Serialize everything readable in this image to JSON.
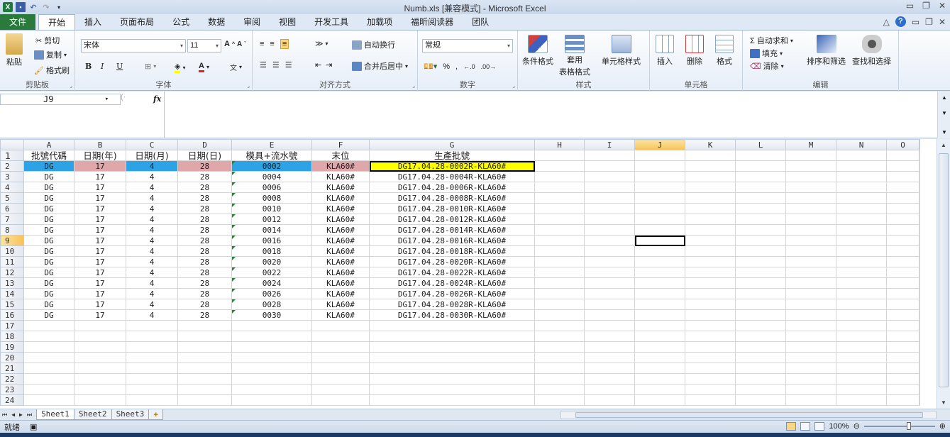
{
  "window": {
    "title": "Numb.xls  [兼容模式] - Microsoft Excel"
  },
  "ribbon_tabs": [
    "文件",
    "开始",
    "插入",
    "页面布局",
    "公式",
    "数据",
    "审阅",
    "视图",
    "开发工具",
    "加载项",
    "福昕阅读器",
    "团队"
  ],
  "active_tab": "开始",
  "clipboard": {
    "paste": "粘贴",
    "cut": "剪切",
    "copy": "复制",
    "format_painter": "格式刷",
    "label": "剪贴板"
  },
  "font": {
    "name": "宋体",
    "size": "11",
    "label": "字体",
    "bold": "B",
    "italic": "I",
    "underline": "U"
  },
  "alignment": {
    "wrap": "自动换行",
    "merge": "合并后居中",
    "label": "对齐方式"
  },
  "number": {
    "format": "常规",
    "label": "数字",
    "percent": "%",
    "comma": ","
  },
  "styles": {
    "conditional": "条件格式",
    "table_format": "套用\n表格格式",
    "table_format_a": "套用",
    "table_format_b": "表格格式",
    "cell_styles": "单元格样式",
    "label": "样式"
  },
  "cells": {
    "insert": "插入",
    "delete": "删除",
    "format": "格式",
    "label": "单元格"
  },
  "editing": {
    "autosum": "Σ 自动求和",
    "fill": "填充",
    "clear": "清除",
    "sort": "排序和筛选",
    "find": "查找和选择",
    "label": "编辑"
  },
  "formula_bar": {
    "name_box": "J9",
    "fx": "fx",
    "content": ""
  },
  "columns": [
    "A",
    "B",
    "C",
    "D",
    "E",
    "F",
    "G",
    "H",
    "I",
    "J",
    "K",
    "L",
    "M",
    "N",
    "O"
  ],
  "header_row": [
    "批號代碼",
    "日期(年)",
    "日期(月)",
    "日期(日)",
    "模具+流水號",
    "末位",
    "生產批號"
  ],
  "rows": [
    [
      "DG",
      "17",
      "4",
      "28",
      "0002",
      "KLA60#",
      "DG17.04.28-0002R-KLA60#"
    ],
    [
      "DG",
      "17",
      "4",
      "28",
      "0004",
      "KLA60#",
      "DG17.04.28-0004R-KLA60#"
    ],
    [
      "DG",
      "17",
      "4",
      "28",
      "0006",
      "KLA60#",
      "DG17.04.28-0006R-KLA60#"
    ],
    [
      "DG",
      "17",
      "4",
      "28",
      "0008",
      "KLA60#",
      "DG17.04.28-0008R-KLA60#"
    ],
    [
      "DG",
      "17",
      "4",
      "28",
      "0010",
      "KLA60#",
      "DG17.04.28-0010R-KLA60#"
    ],
    [
      "DG",
      "17",
      "4",
      "28",
      "0012",
      "KLA60#",
      "DG17.04.28-0012R-KLA60#"
    ],
    [
      "DG",
      "17",
      "4",
      "28",
      "0014",
      "KLA60#",
      "DG17.04.28-0014R-KLA60#"
    ],
    [
      "DG",
      "17",
      "4",
      "28",
      "0016",
      "KLA60#",
      "DG17.04.28-0016R-KLA60#"
    ],
    [
      "DG",
      "17",
      "4",
      "28",
      "0018",
      "KLA60#",
      "DG17.04.28-0018R-KLA60#"
    ],
    [
      "DG",
      "17",
      "4",
      "28",
      "0020",
      "KLA60#",
      "DG17.04.28-0020R-KLA60#"
    ],
    [
      "DG",
      "17",
      "4",
      "28",
      "0022",
      "KLA60#",
      "DG17.04.28-0022R-KLA60#"
    ],
    [
      "DG",
      "17",
      "4",
      "28",
      "0024",
      "KLA60#",
      "DG17.04.28-0024R-KLA60#"
    ],
    [
      "DG",
      "17",
      "4",
      "28",
      "0026",
      "KLA60#",
      "DG17.04.28-0026R-KLA60#"
    ],
    [
      "DG",
      "17",
      "4",
      "28",
      "0028",
      "KLA60#",
      "DG17.04.28-0028R-KLA60#"
    ],
    [
      "DG",
      "17",
      "4",
      "28",
      "0030",
      "KLA60#",
      "DG17.04.28-0030R-KLA60#"
    ]
  ],
  "row_numbers": [
    "1",
    "2",
    "3",
    "4",
    "5",
    "6",
    "7",
    "8",
    "9",
    "10",
    "11",
    "12",
    "13",
    "14",
    "15",
    "16",
    "17",
    "18",
    "19",
    "20",
    "21",
    "22",
    "23",
    "24"
  ],
  "active_cell": "J9",
  "row2_fills": [
    "#2da3e6",
    "#dfa7a9",
    "#2da3e6",
    "#dfa7a9",
    "#2da3e6",
    "#dfa7a9",
    "#ffff00"
  ],
  "sheets": [
    "Sheet1",
    "Sheet2",
    "Sheet3"
  ],
  "active_sheet": "Sheet1",
  "status": {
    "ready": "就绪",
    "zoom": "100%"
  }
}
